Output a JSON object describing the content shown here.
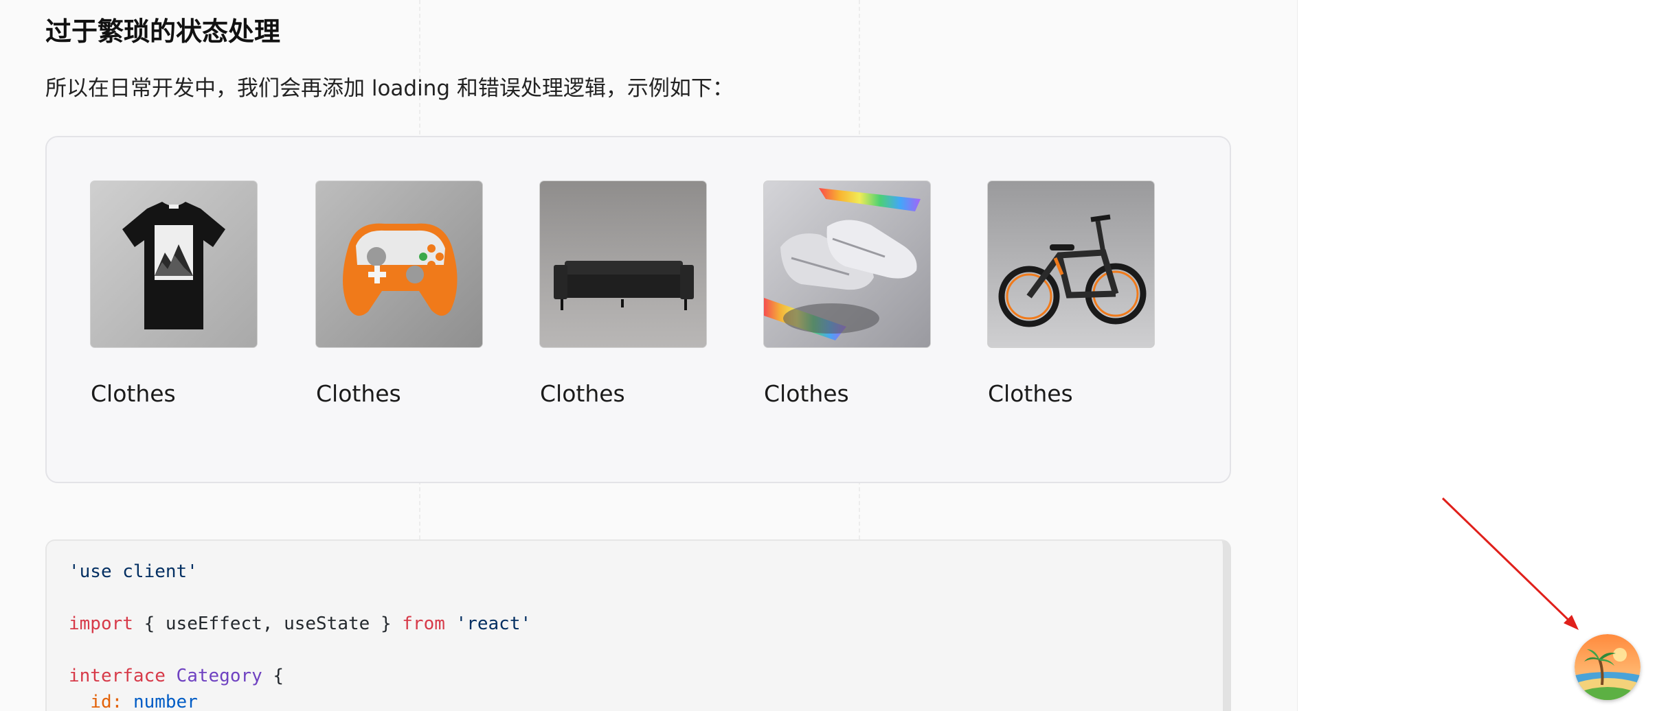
{
  "article": {
    "heading": "过于繁琐的状态处理",
    "paragraph": "所以在日常开发中，我们会再添加 loading 和错误处理逻辑，示例如下："
  },
  "products": [
    {
      "name": "Clothes",
      "image_subject": "black t-shirt with mountain print"
    },
    {
      "name": "Clothes",
      "image_subject": "orange and white game controller"
    },
    {
      "name": "Clothes",
      "image_subject": "black leather sofa"
    },
    {
      "name": "Clothes",
      "image_subject": "silver running sneakers with rainbow light"
    },
    {
      "name": "Clothes",
      "image_subject": "black electric bicycle with orange accents"
    }
  ],
  "code": {
    "lines": [
      [
        {
          "t": "'use client'",
          "c": "str"
        }
      ],
      [],
      [
        {
          "t": "import",
          "c": "kw"
        },
        {
          "t": " { useEffect, useState } ",
          "c": "plain"
        },
        {
          "t": "from",
          "c": "kw"
        },
        {
          "t": " ",
          "c": "plain"
        },
        {
          "t": "'react'",
          "c": "str"
        }
      ],
      [],
      [
        {
          "t": "interface",
          "c": "kw"
        },
        {
          "t": " ",
          "c": "plain"
        },
        {
          "t": "Category",
          "c": "type"
        },
        {
          "t": " {",
          "c": "plain"
        }
      ],
      [
        {
          "t": "  ",
          "c": "plain"
        },
        {
          "t": "id",
          "c": "prop"
        },
        {
          "t": ": ",
          "c": "prop"
        },
        {
          "t": "number",
          "c": "num"
        }
      ]
    ]
  },
  "floating_avatar": {
    "icon": "palm-tree-beach-avatar-icon"
  },
  "annotation": {
    "arrow_color": "#e0201b"
  },
  "colors": {
    "keyword": "#d73a49",
    "string": "#032f62",
    "type": "#6f42c1",
    "property": "#e36209",
    "number": "#005cc5"
  }
}
